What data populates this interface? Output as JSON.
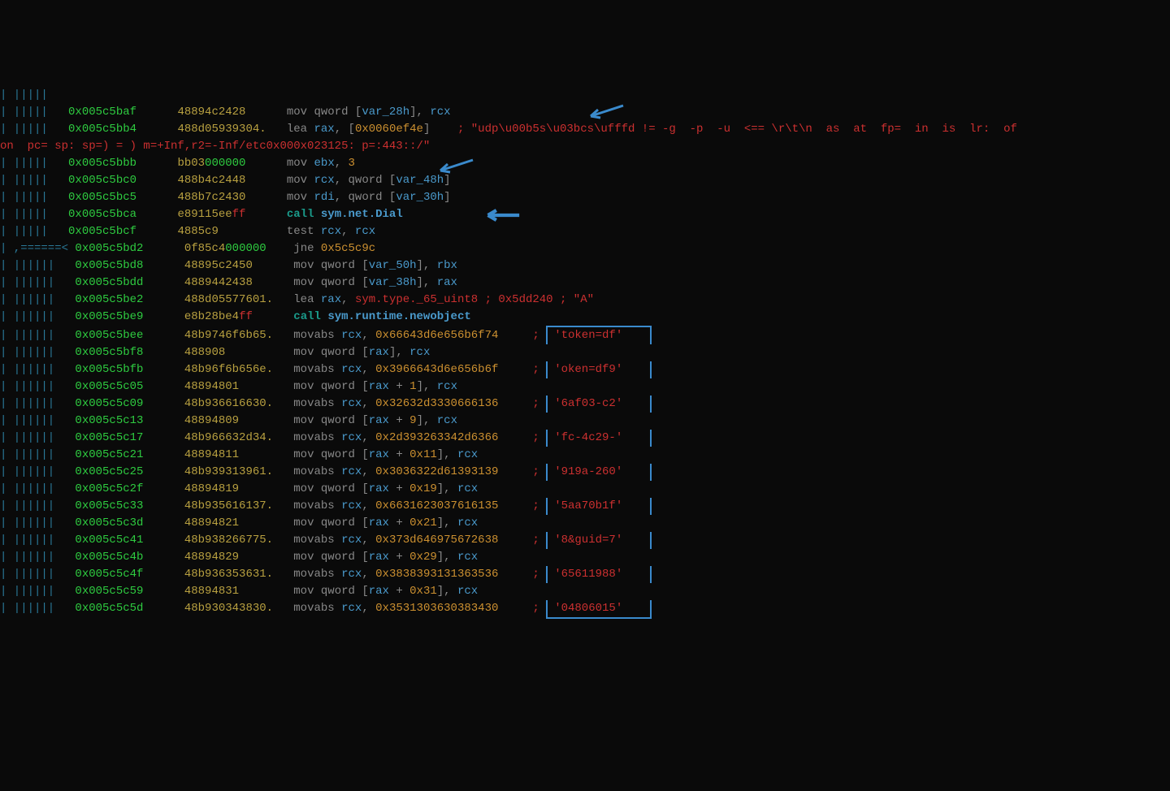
{
  "lines": [
    {
      "pipes": "| |||||   ",
      "addr": "",
      "hex": "",
      "parts": []
    },
    {
      "pipes": "| |||||   ",
      "addr": "0x005c5baf",
      "hex": "48894c2428",
      "parts": [
        {
          "t": "mnemonic",
          "v": "mov"
        },
        {
          "t": "sp",
          "v": " "
        },
        {
          "t": "operand",
          "v": "qword ["
        },
        {
          "t": "var",
          "v": "var_28h"
        },
        {
          "t": "operand",
          "v": "], "
        },
        {
          "t": "reg",
          "v": "rcx"
        }
      ]
    },
    {
      "pipes": "| |||||   ",
      "addr": "0x005c5bb4",
      "hex": "488d05939304.",
      "parts": [
        {
          "t": "mnemonic",
          "v": "lea"
        },
        {
          "t": "sp",
          "v": " "
        },
        {
          "t": "reg",
          "v": "rax"
        },
        {
          "t": "operand",
          "v": ", ["
        },
        {
          "t": "num",
          "v": "0x0060ef4e"
        },
        {
          "t": "operand",
          "v": "]"
        }
      ],
      "comment": "    ; \"udp\\u00b5s\\u03bcs\\ufffd != -g  -p  -u  <== \\r\\t\\n  as  at  fp=  in  is  lr:  of"
    },
    {
      "wrap": "on  pc= sp: sp=) = ) m=+Inf,r2=-Inf/etc0x000x023125: p=:443::/\""
    },
    {
      "pipes": "| |||||   ",
      "addr": "0x005c5bbb",
      "hex": "bb03",
      "hexgreen": "000000",
      "parts": [
        {
          "t": "mnemonic",
          "v": "mov"
        },
        {
          "t": "sp",
          "v": " "
        },
        {
          "t": "reg",
          "v": "ebx"
        },
        {
          "t": "operand",
          "v": ", "
        },
        {
          "t": "num",
          "v": "3"
        }
      ]
    },
    {
      "pipes": "| |||||   ",
      "addr": "0x005c5bc0",
      "hex": "488b4c2448",
      "parts": [
        {
          "t": "mnemonic",
          "v": "mov"
        },
        {
          "t": "sp",
          "v": " "
        },
        {
          "t": "reg",
          "v": "rcx"
        },
        {
          "t": "operand",
          "v": ", qword ["
        },
        {
          "t": "var",
          "v": "var_48h"
        },
        {
          "t": "operand",
          "v": "]"
        }
      ]
    },
    {
      "pipes": "| |||||   ",
      "addr": "0x005c5bc5",
      "hex": "488b7c2430",
      "parts": [
        {
          "t": "mnemonic",
          "v": "mov"
        },
        {
          "t": "sp",
          "v": " "
        },
        {
          "t": "reg",
          "v": "rdi"
        },
        {
          "t": "operand",
          "v": ", qword ["
        },
        {
          "t": "var",
          "v": "var_30h"
        },
        {
          "t": "operand",
          "v": "]"
        }
      ]
    },
    {
      "pipes": "| |||||   ",
      "addr": "0x005c5bca",
      "hex": "e89115ee",
      "hexred": "ff",
      "parts": [
        {
          "t": "call",
          "v": "call"
        },
        {
          "t": "sp",
          "v": " "
        },
        {
          "t": "symcall",
          "v": "sym.net.Dial"
        }
      ]
    },
    {
      "pipes": "| |||||   ",
      "addr": "0x005c5bcf",
      "hex": "4885c9",
      "parts": [
        {
          "t": "mnemonic",
          "v": "test"
        },
        {
          "t": "sp",
          "v": " "
        },
        {
          "t": "reg",
          "v": "rcx"
        },
        {
          "t": "operand",
          "v": ", "
        },
        {
          "t": "reg",
          "v": "rcx"
        }
      ]
    },
    {
      "pipes": "| ,======< ",
      "addr": "0x005c5bd2",
      "hex": "0f85c4",
      "hexgreen": "000000",
      "parts": [
        {
          "t": "mnemonic",
          "v": "jne"
        },
        {
          "t": "sp",
          "v": " "
        },
        {
          "t": "num",
          "v": "0x5c5c9c"
        }
      ]
    },
    {
      "pipes": "| ||||||   ",
      "addr": "0x005c5bd8",
      "hex": "48895c2450",
      "parts": [
        {
          "t": "mnemonic",
          "v": "mov"
        },
        {
          "t": "sp",
          "v": " "
        },
        {
          "t": "operand",
          "v": "qword ["
        },
        {
          "t": "var",
          "v": "var_50h"
        },
        {
          "t": "operand",
          "v": "], "
        },
        {
          "t": "reg",
          "v": "rbx"
        }
      ]
    },
    {
      "pipes": "| ||||||   ",
      "addr": "0x005c5bdd",
      "hex": "4889442438",
      "parts": [
        {
          "t": "mnemonic",
          "v": "mov"
        },
        {
          "t": "sp",
          "v": " "
        },
        {
          "t": "operand",
          "v": "qword ["
        },
        {
          "t": "var",
          "v": "var_38h"
        },
        {
          "t": "operand",
          "v": "], "
        },
        {
          "t": "reg",
          "v": "rax"
        }
      ]
    },
    {
      "pipes": "| ||||||   ",
      "addr": "0x005c5be2",
      "hex": "488d05577601.",
      "parts": [
        {
          "t": "mnemonic",
          "v": "lea"
        },
        {
          "t": "sp",
          "v": " "
        },
        {
          "t": "reg",
          "v": "rax"
        },
        {
          "t": "operand",
          "v": ", "
        },
        {
          "t": "sym",
          "v": "sym.type._65_uint8"
        }
      ],
      "comment": " ; 0x5dd240 ; \"A\""
    },
    {
      "pipes": "| ||||||   ",
      "addr": "0x005c5be9",
      "hex": "e8b28be4",
      "hexred": "ff",
      "parts": [
        {
          "t": "call",
          "v": "call"
        },
        {
          "t": "sp",
          "v": " "
        },
        {
          "t": "symcall",
          "v": "sym.runtime.newobject"
        }
      ]
    },
    {
      "pipes": "| ||||||   ",
      "addr": "0x005c5bee",
      "hex": "48b9746f6b65.",
      "parts": [
        {
          "t": "mnemonic",
          "v": "movabs"
        },
        {
          "t": "sp",
          "v": " "
        },
        {
          "t": "reg",
          "v": "rcx"
        },
        {
          "t": "operand",
          "v": ", "
        },
        {
          "t": "num",
          "v": "0x66643d6e656b6f74"
        }
      ],
      "boxed": "'token=df'",
      "semi": " ; "
    },
    {
      "pipes": "| ||||||   ",
      "addr": "0x005c5bf8",
      "hex": "488908",
      "parts": [
        {
          "t": "mnemonic",
          "v": "mov"
        },
        {
          "t": "sp",
          "v": " "
        },
        {
          "t": "operand",
          "v": "qword ["
        },
        {
          "t": "reg",
          "v": "rax"
        },
        {
          "t": "operand",
          "v": "], "
        },
        {
          "t": "reg",
          "v": "rcx"
        }
      ],
      "boxedEmpty": true
    },
    {
      "pipes": "| ||||||   ",
      "addr": "0x005c5bfb",
      "hex": "48b96f6b656e.",
      "parts": [
        {
          "t": "mnemonic",
          "v": "movabs"
        },
        {
          "t": "sp",
          "v": " "
        },
        {
          "t": "reg",
          "v": "rcx"
        },
        {
          "t": "operand",
          "v": ", "
        },
        {
          "t": "num",
          "v": "0x3966643d6e656b6f"
        }
      ],
      "boxed": "'oken=df9'",
      "semi": " ; "
    },
    {
      "pipes": "| ||||||   ",
      "addr": "0x005c5c05",
      "hex": "48894801",
      "parts": [
        {
          "t": "mnemonic",
          "v": "mov"
        },
        {
          "t": "sp",
          "v": " "
        },
        {
          "t": "operand",
          "v": "qword ["
        },
        {
          "t": "reg",
          "v": "rax"
        },
        {
          "t": "operand",
          "v": " + "
        },
        {
          "t": "num",
          "v": "1"
        },
        {
          "t": "operand",
          "v": "], "
        },
        {
          "t": "reg",
          "v": "rcx"
        }
      ],
      "boxedEmpty": true
    },
    {
      "pipes": "| ||||||   ",
      "addr": "0x005c5c09",
      "hex": "48b936616630.",
      "parts": [
        {
          "t": "mnemonic",
          "v": "movabs"
        },
        {
          "t": "sp",
          "v": " "
        },
        {
          "t": "reg",
          "v": "rcx"
        },
        {
          "t": "operand",
          "v": ", "
        },
        {
          "t": "num",
          "v": "0x32632d3330666136"
        }
      ],
      "boxed": "'6af03-c2'",
      "semi": " ; "
    },
    {
      "pipes": "| ||||||   ",
      "addr": "0x005c5c13",
      "hex": "48894809",
      "parts": [
        {
          "t": "mnemonic",
          "v": "mov"
        },
        {
          "t": "sp",
          "v": " "
        },
        {
          "t": "operand",
          "v": "qword ["
        },
        {
          "t": "reg",
          "v": "rax"
        },
        {
          "t": "operand",
          "v": " + "
        },
        {
          "t": "num",
          "v": "9"
        },
        {
          "t": "operand",
          "v": "], "
        },
        {
          "t": "reg",
          "v": "rcx"
        }
      ],
      "boxedEmpty": true
    },
    {
      "pipes": "| ||||||   ",
      "addr": "0x005c5c17",
      "hex": "48b966632d34.",
      "parts": [
        {
          "t": "mnemonic",
          "v": "movabs"
        },
        {
          "t": "sp",
          "v": " "
        },
        {
          "t": "reg",
          "v": "rcx"
        },
        {
          "t": "operand",
          "v": ", "
        },
        {
          "t": "num",
          "v": "0x2d393263342d6366"
        }
      ],
      "boxed": "'fc-4c29-'",
      "semi": " ; "
    },
    {
      "pipes": "| ||||||   ",
      "addr": "0x005c5c21",
      "hex": "48894811",
      "parts": [
        {
          "t": "mnemonic",
          "v": "mov"
        },
        {
          "t": "sp",
          "v": " "
        },
        {
          "t": "operand",
          "v": "qword ["
        },
        {
          "t": "reg",
          "v": "rax"
        },
        {
          "t": "operand",
          "v": " + "
        },
        {
          "t": "num",
          "v": "0x11"
        },
        {
          "t": "operand",
          "v": "], "
        },
        {
          "t": "reg",
          "v": "rcx"
        }
      ],
      "boxedEmpty": true
    },
    {
      "pipes": "| ||||||   ",
      "addr": "0x005c5c25",
      "hex": "48b939313961.",
      "parts": [
        {
          "t": "mnemonic",
          "v": "movabs"
        },
        {
          "t": "sp",
          "v": " "
        },
        {
          "t": "reg",
          "v": "rcx"
        },
        {
          "t": "operand",
          "v": ", "
        },
        {
          "t": "num",
          "v": "0x3036322d61393139"
        }
      ],
      "boxed": "'919a-260'",
      "semi": " ; "
    },
    {
      "pipes": "| ||||||   ",
      "addr": "0x005c5c2f",
      "hex": "48894819",
      "parts": [
        {
          "t": "mnemonic",
          "v": "mov"
        },
        {
          "t": "sp",
          "v": " "
        },
        {
          "t": "operand",
          "v": "qword ["
        },
        {
          "t": "reg",
          "v": "rax"
        },
        {
          "t": "operand",
          "v": " + "
        },
        {
          "t": "num",
          "v": "0x19"
        },
        {
          "t": "operand",
          "v": "], "
        },
        {
          "t": "reg",
          "v": "rcx"
        }
      ],
      "boxedEmpty": true
    },
    {
      "pipes": "| ||||||   ",
      "addr": "0x005c5c33",
      "hex": "48b935616137.",
      "parts": [
        {
          "t": "mnemonic",
          "v": "movabs"
        },
        {
          "t": "sp",
          "v": " "
        },
        {
          "t": "reg",
          "v": "rcx"
        },
        {
          "t": "operand",
          "v": ", "
        },
        {
          "t": "num",
          "v": "0x6631623037616135"
        }
      ],
      "boxed": "'5aa70b1f'",
      "semi": " ; "
    },
    {
      "pipes": "| ||||||   ",
      "addr": "0x005c5c3d",
      "hex": "48894821",
      "parts": [
        {
          "t": "mnemonic",
          "v": "mov"
        },
        {
          "t": "sp",
          "v": " "
        },
        {
          "t": "operand",
          "v": "qword ["
        },
        {
          "t": "reg",
          "v": "rax"
        },
        {
          "t": "operand",
          "v": " + "
        },
        {
          "t": "num",
          "v": "0x21"
        },
        {
          "t": "operand",
          "v": "], "
        },
        {
          "t": "reg",
          "v": "rcx"
        }
      ],
      "boxedEmpty": true
    },
    {
      "pipes": "| ||||||   ",
      "addr": "0x005c5c41",
      "hex": "48b938266775.",
      "parts": [
        {
          "t": "mnemonic",
          "v": "movabs"
        },
        {
          "t": "sp",
          "v": " "
        },
        {
          "t": "reg",
          "v": "rcx"
        },
        {
          "t": "operand",
          "v": ", "
        },
        {
          "t": "num",
          "v": "0x373d646975672638"
        }
      ],
      "boxed": "'8&guid=7'",
      "semi": " ; "
    },
    {
      "pipes": "| ||||||   ",
      "addr": "0x005c5c4b",
      "hex": "48894829",
      "parts": [
        {
          "t": "mnemonic",
          "v": "mov"
        },
        {
          "t": "sp",
          "v": " "
        },
        {
          "t": "operand",
          "v": "qword ["
        },
        {
          "t": "reg",
          "v": "rax"
        },
        {
          "t": "operand",
          "v": " + "
        },
        {
          "t": "num",
          "v": "0x29"
        },
        {
          "t": "operand",
          "v": "], "
        },
        {
          "t": "reg",
          "v": "rcx"
        }
      ],
      "boxedEmpty": true
    },
    {
      "pipes": "| ||||||   ",
      "addr": "0x005c5c4f",
      "hex": "48b936353631.",
      "parts": [
        {
          "t": "mnemonic",
          "v": "movabs"
        },
        {
          "t": "sp",
          "v": " "
        },
        {
          "t": "reg",
          "v": "rcx"
        },
        {
          "t": "operand",
          "v": ", "
        },
        {
          "t": "num",
          "v": "0x3838393131363536"
        }
      ],
      "boxed": "'65611988'",
      "semi": " ; "
    },
    {
      "pipes": "| ||||||   ",
      "addr": "0x005c5c59",
      "hex": "48894831",
      "parts": [
        {
          "t": "mnemonic",
          "v": "mov"
        },
        {
          "t": "sp",
          "v": " "
        },
        {
          "t": "operand",
          "v": "qword ["
        },
        {
          "t": "reg",
          "v": "rax"
        },
        {
          "t": "operand",
          "v": " + "
        },
        {
          "t": "num",
          "v": "0x31"
        },
        {
          "t": "operand",
          "v": "], "
        },
        {
          "t": "reg",
          "v": "rcx"
        }
      ],
      "boxedEmpty": true
    },
    {
      "pipes": "| ||||||   ",
      "addr": "0x005c5c5d",
      "hex": "48b930343830.",
      "parts": [
        {
          "t": "mnemonic",
          "v": "movabs"
        },
        {
          "t": "sp",
          "v": " "
        },
        {
          "t": "reg",
          "v": "rcx"
        },
        {
          "t": "operand",
          "v": ", "
        },
        {
          "t": "num",
          "v": "0x3531303630383430"
        }
      ],
      "boxed": "'04806015'",
      "semi": " ; "
    }
  ]
}
